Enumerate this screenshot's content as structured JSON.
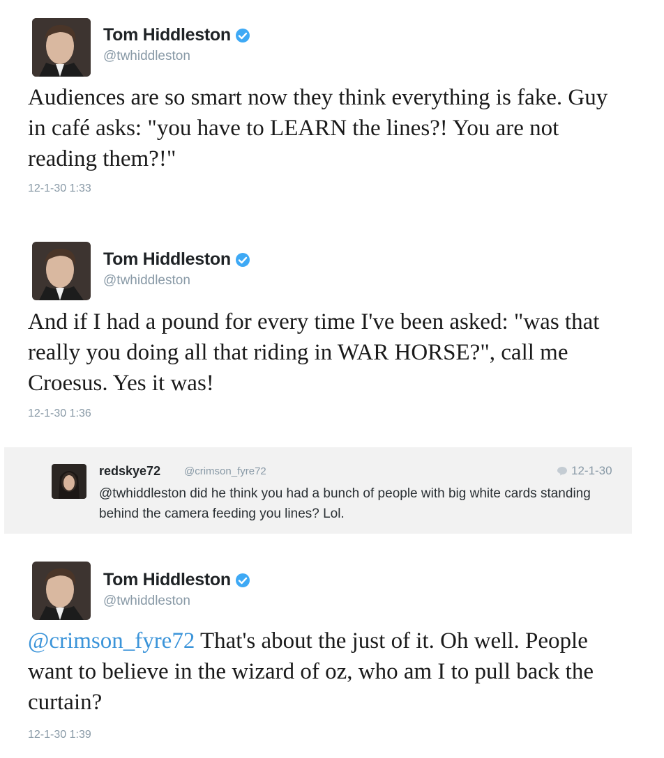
{
  "tweets": [
    {
      "user": "Tom Hiddleston",
      "handle": "@twhiddleston",
      "text": "Audiences are so smart now they think everything is fake. Guy in café asks: \"you have to LEARN the lines?! You are not reading them?!\"",
      "timestamp": "12-1-30 1:33"
    },
    {
      "user": "Tom Hiddleston",
      "handle": "@twhiddleston",
      "text": "And if I had a pound for every time I've been asked: \"was that really you doing all that riding in WAR HORSE?\", call me Croesus. Yes it was!",
      "timestamp": "12-1-30 1:36"
    },
    {
      "user": "Tom Hiddleston",
      "handle": "@twhiddleston",
      "mention": "@crimson_fyre72",
      "text": " That's about the just of it. Oh well. People want to believe in the wizard of oz, who am I to pull back the curtain?",
      "timestamp": "12-1-30 1:39"
    }
  ],
  "reply": {
    "user": "redskye72",
    "handle": "@crimson_fyre72",
    "date": "12-1-30",
    "text": "@twhiddleston did he think you had a bunch of people with big white cards standing behind the camera feeding you lines? Lol."
  },
  "colors": {
    "verified": "#3ea9f5",
    "mention": "#3b94d9",
    "muted": "#8899a6"
  }
}
